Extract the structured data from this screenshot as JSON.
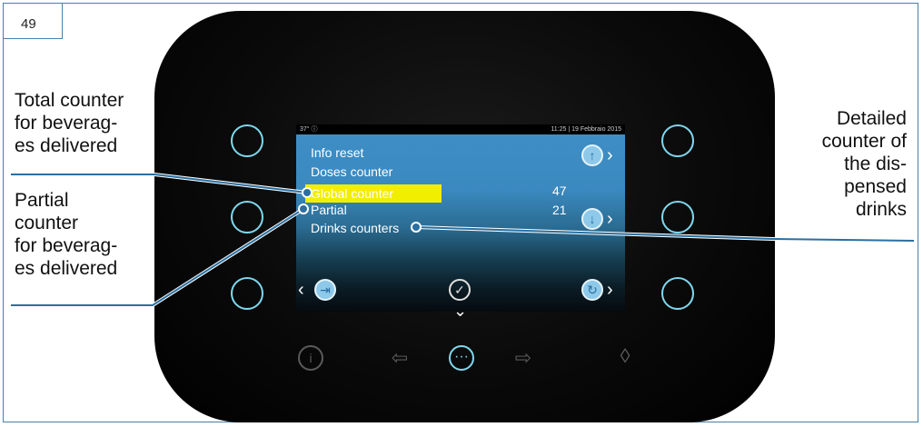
{
  "page_number": "49",
  "statusbar": {
    "left": "37° ⓘ",
    "right": "11:25 | 19 Febbraio 2015"
  },
  "menu": {
    "items": [
      "Info reset",
      "Doses counter",
      "Global counter",
      "Partial",
      "Drinks counters"
    ],
    "values": {
      "global": "47",
      "partial": "21"
    }
  },
  "callouts": {
    "total": [
      "Total counter",
      "for beverag-",
      "es delivered"
    ],
    "partial": [
      "Partial",
      "counter",
      "for beverag-",
      "es delivered"
    ],
    "detailed": [
      "Detailed",
      "counter of",
      "the dis-",
      "pensed",
      "drinks"
    ]
  },
  "icons": {
    "up": "arrow-up-icon",
    "down": "arrow-down-icon",
    "exit": "exit-icon",
    "check": "check-icon",
    "refresh": "refresh-icon",
    "info": "info-icon",
    "left": "arrow-left-icon",
    "more": "more-icon",
    "right": "arrow-right-icon",
    "drop": "drop-icon"
  },
  "colors": {
    "accent": "#7fd8ee",
    "highlight": "#f2ee00",
    "frame": "#4a7fa8",
    "line": "#2a6fa0"
  }
}
